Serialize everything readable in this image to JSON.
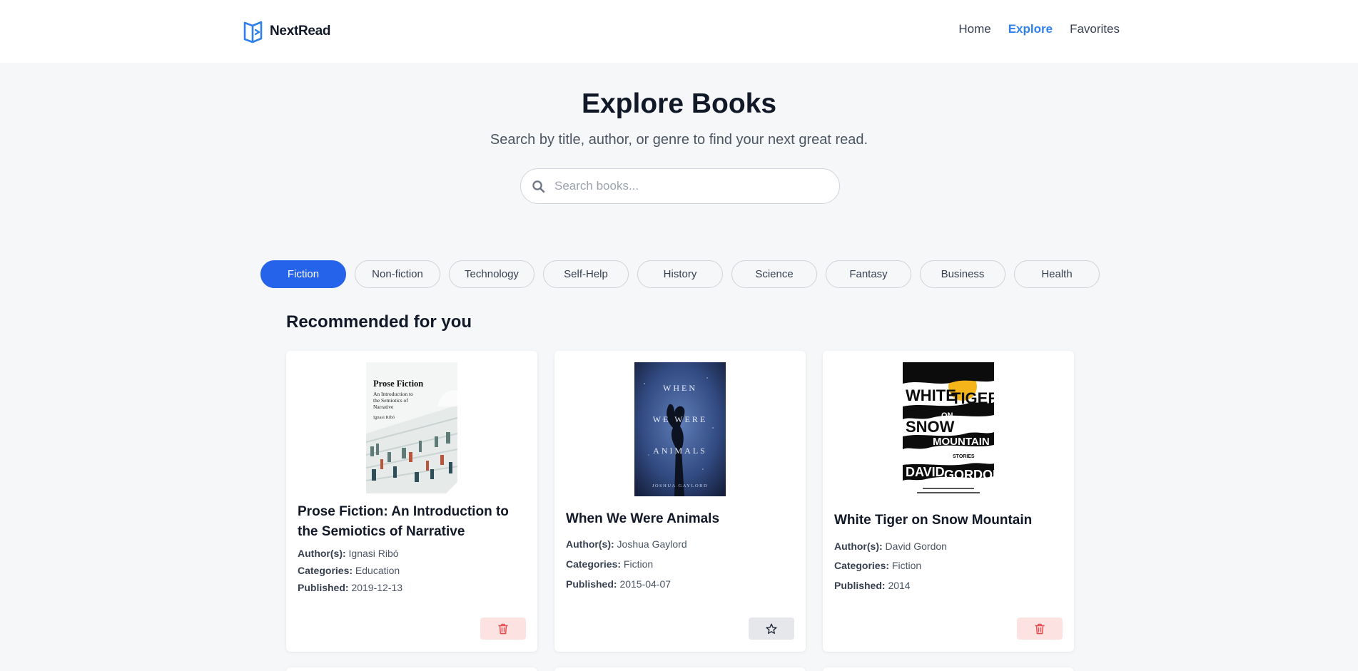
{
  "header": {
    "logo_text": "NextRead",
    "nav": [
      {
        "label": "Home",
        "active": false
      },
      {
        "label": "Explore",
        "active": true
      },
      {
        "label": "Favorites",
        "active": false
      }
    ]
  },
  "hero": {
    "title": "Explore Books",
    "subtitle": "Search by title, author, or genre to find your next great read.",
    "search_placeholder": "Search books..."
  },
  "genres": [
    {
      "label": "Fiction",
      "active": true
    },
    {
      "label": "Non-fiction",
      "active": false
    },
    {
      "label": "Technology",
      "active": false
    },
    {
      "label": "Self-Help",
      "active": false
    },
    {
      "label": "History",
      "active": false
    },
    {
      "label": "Science",
      "active": false
    },
    {
      "label": "Fantasy",
      "active": false
    },
    {
      "label": "Business",
      "active": false
    },
    {
      "label": "Health",
      "active": false
    }
  ],
  "section": {
    "title": "Recommended for you"
  },
  "labels": {
    "authors": "Author(s):",
    "categories": "Categories:",
    "published": "Published:"
  },
  "books": [
    {
      "title": "Prose Fiction: An Introduction to the Semiotics of Narrative",
      "authors": "Ignasi Ribó",
      "categories": "Education",
      "published": "2019-12-13",
      "action": "delete-icon",
      "cover": {
        "title": "Prose Fiction",
        "subtitle_lines": [
          "An Introduction to",
          "the Semiotics of",
          "Narrative"
        ],
        "author": "Ignasi Ribó"
      }
    },
    {
      "title": "When We Were Animals",
      "authors": "Joshua Gaylord",
      "categories": "Fiction",
      "published": "2015-04-07",
      "action": "star-icon",
      "cover": {
        "title_lines": [
          "WHEN",
          "WE WERE",
          "ANIMALS"
        ],
        "author": "JOSHUA GAYLORD"
      }
    },
    {
      "title": "White Tiger on Snow Mountain",
      "authors": "David Gordon",
      "categories": "Fiction",
      "published": "2014",
      "action": "delete-icon",
      "cover": {
        "title_words": [
          "WHITE",
          "TIGER",
          "ON",
          "SNOW",
          "MOUNTAIN"
        ],
        "tag": "STORIES",
        "author_words": [
          "DAVID",
          "GORDON"
        ]
      }
    }
  ],
  "colors": {
    "accent": "#2563eb",
    "nav_active": "#2f80ed",
    "delete_bg": "#fde2e2",
    "delete_icon": "#e5484d",
    "fav_bg": "#e5e7eb"
  }
}
